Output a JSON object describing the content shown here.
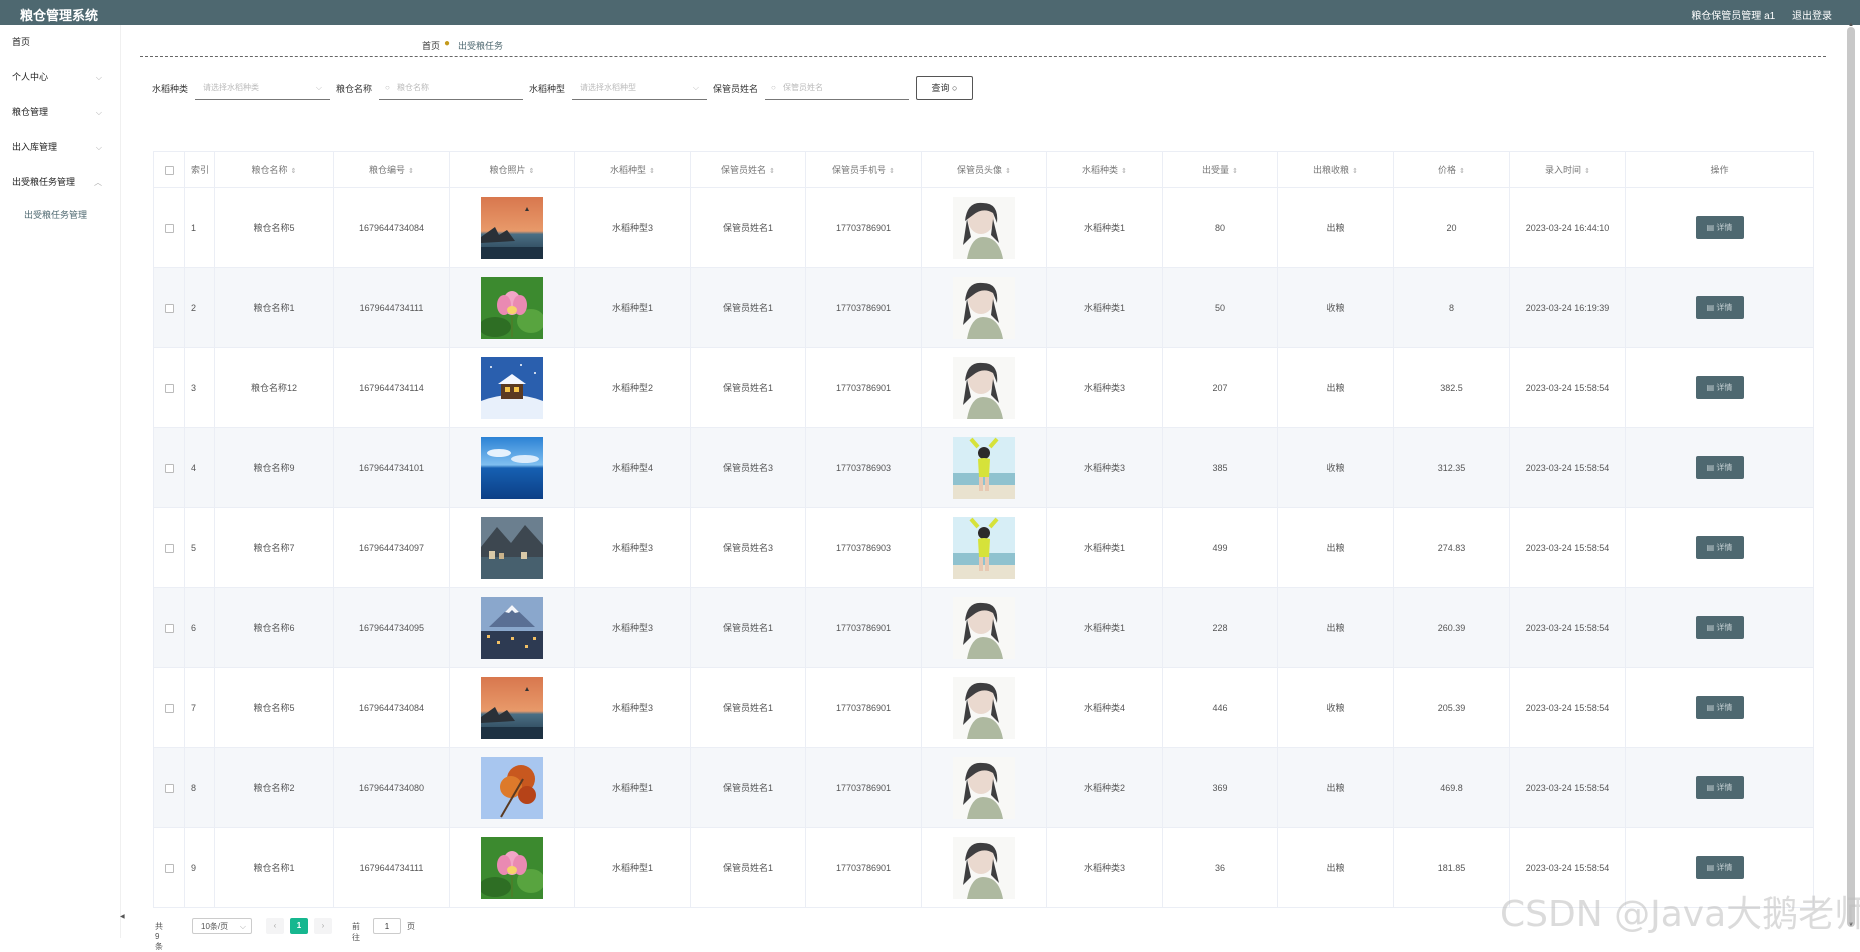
{
  "app": {
    "title": "粮仓管理系统",
    "user_label": "粮仓保管员管理 a1",
    "logout": "退出登录"
  },
  "sidebar": {
    "items": [
      {
        "label": "首页",
        "has_children": false
      },
      {
        "label": "个人中心",
        "has_children": true
      },
      {
        "label": "粮仓管理",
        "has_children": true
      },
      {
        "label": "出入库管理",
        "has_children": true
      },
      {
        "label": "出受粮任务管理",
        "has_children": true,
        "expanded": true
      }
    ],
    "sub_items": [
      {
        "label": "出受粮任务管理"
      }
    ]
  },
  "breadcrumb": {
    "home": "首页",
    "current": "出受粮任务"
  },
  "search": {
    "rice_type_label": "水稻种类",
    "rice_type_placeholder": "请选择水稻种类",
    "granary_name_label": "粮仓名称",
    "granary_name_placeholder": "粮仓名称",
    "rice_variety_label": "水稻种型",
    "rice_variety_placeholder": "请选择水稻种型",
    "keeper_name_label": "保管员姓名",
    "keeper_name_placeholder": "保管员姓名",
    "query_button": "查询"
  },
  "table": {
    "headers": {
      "index": "索引",
      "granary_name": "粮仓名称",
      "granary_no": "粮仓编号",
      "granary_photo": "粮仓照片",
      "rice_variety": "水稻种型",
      "keeper_name": "保管员姓名",
      "keeper_phone": "保管员手机号",
      "keeper_avatar": "保管员头像",
      "rice_type": "水稻种类",
      "volume": "出受量",
      "direction": "出粮收粮",
      "price": "价格",
      "entry_time": "录入时间",
      "action": "操作"
    },
    "detail_label": "详情",
    "rows": [
      {
        "index": "1",
        "granary_name": "粮仓名称5",
        "granary_no": "1679644734084",
        "photo": "sunset-lake",
        "rice_variety": "水稻种型3",
        "keeper_name": "保管员姓名1",
        "keeper_phone": "17703786901",
        "avatar": "girl-sketch",
        "rice_type": "水稻种类1",
        "volume": "80",
        "direction": "出粮",
        "price": "20",
        "entry_time": "2023-03-24 16:44:10"
      },
      {
        "index": "2",
        "granary_name": "粮仓名称1",
        "granary_no": "1679644734111",
        "photo": "lotus",
        "rice_variety": "水稻种型1",
        "keeper_name": "保管员姓名1",
        "keeper_phone": "17703786901",
        "avatar": "girl-sketch",
        "rice_type": "水稻种类1",
        "volume": "50",
        "direction": "收粮",
        "price": "8",
        "entry_time": "2023-03-24 16:19:39"
      },
      {
        "index": "3",
        "granary_name": "粮仓名称12",
        "granary_no": "1679644734114",
        "photo": "snow-house",
        "rice_variety": "水稻种型2",
        "keeper_name": "保管员姓名1",
        "keeper_phone": "17703786901",
        "avatar": "girl-sketch",
        "rice_type": "水稻种类3",
        "volume": "207",
        "direction": "出粮",
        "price": "382.5",
        "entry_time": "2023-03-24 15:58:54"
      },
      {
        "index": "4",
        "granary_name": "粮仓名称9",
        "granary_no": "1679644734101",
        "photo": "blue-sea",
        "rice_variety": "水稻种型4",
        "keeper_name": "保管员姓名3",
        "keeper_phone": "17703786903",
        "avatar": "girl-beach",
        "rice_type": "水稻种类3",
        "volume": "385",
        "direction": "收粮",
        "price": "312.35",
        "entry_time": "2023-03-24 15:58:54"
      },
      {
        "index": "5",
        "granary_name": "粮仓名称7",
        "granary_no": "1679644734097",
        "photo": "mountain-town",
        "rice_variety": "水稻种型3",
        "keeper_name": "保管员姓名3",
        "keeper_phone": "17703786903",
        "avatar": "girl-beach",
        "rice_type": "水稻种类1",
        "volume": "499",
        "direction": "出粮",
        "price": "274.83",
        "entry_time": "2023-03-24 15:58:54"
      },
      {
        "index": "6",
        "granary_name": "粮仓名称6",
        "granary_no": "1679644734095",
        "photo": "fuji-city",
        "rice_variety": "水稻种型3",
        "keeper_name": "保管员姓名1",
        "keeper_phone": "17703786901",
        "avatar": "girl-sketch",
        "rice_type": "水稻种类1",
        "volume": "228",
        "direction": "出粮",
        "price": "260.39",
        "entry_time": "2023-03-24 15:58:54"
      },
      {
        "index": "7",
        "granary_name": "粮仓名称5",
        "granary_no": "1679644734084",
        "photo": "sunset-lake",
        "rice_variety": "水稻种型3",
        "keeper_name": "保管员姓名1",
        "keeper_phone": "17703786901",
        "avatar": "girl-sketch",
        "rice_type": "水稻种类4",
        "volume": "446",
        "direction": "收粮",
        "price": "205.39",
        "entry_time": "2023-03-24 15:58:54"
      },
      {
        "index": "8",
        "granary_name": "粮仓名称2",
        "granary_no": "1679644734080",
        "photo": "autumn-leaves",
        "rice_variety": "水稻种型1",
        "keeper_name": "保管员姓名1",
        "keeper_phone": "17703786901",
        "avatar": "girl-sketch",
        "rice_type": "水稻种类2",
        "volume": "369",
        "direction": "出粮",
        "price": "469.8",
        "entry_time": "2023-03-24 15:58:54"
      },
      {
        "index": "9",
        "granary_name": "粮仓名称1",
        "granary_no": "1679644734111",
        "photo": "lotus",
        "rice_variety": "水稻种型1",
        "keeper_name": "保管员姓名1",
        "keeper_phone": "17703786901",
        "avatar": "girl-sketch",
        "rice_type": "水稻种类3",
        "volume": "36",
        "direction": "出粮",
        "price": "181.85",
        "entry_time": "2023-03-24 15:58:54"
      }
    ]
  },
  "pagination": {
    "total": "共 9 条",
    "page_size": "10条/页",
    "current_page": "1",
    "goto_label": "前往",
    "goto_value": "1",
    "page_unit": "页"
  },
  "watermark": "CSDN @Java大鹅老师",
  "colors": {
    "header_bg": "#4e6870",
    "accent": "#4e6870",
    "pager_active": "#16b78f"
  }
}
